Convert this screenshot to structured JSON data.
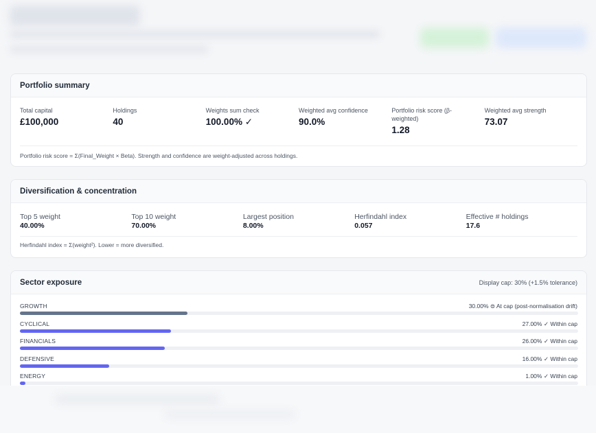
{
  "summary": {
    "title": "Portfolio summary",
    "stats": [
      {
        "label": "Total capital",
        "value": "£100,000"
      },
      {
        "label": "Holdings",
        "value": "40"
      },
      {
        "label": "Weights sum check",
        "value": "100.00% ✓"
      },
      {
        "label": "Weighted avg confidence",
        "value": "90.0%"
      },
      {
        "label": "Portfolio risk score (β-weighted)",
        "value": "1.28"
      },
      {
        "label": "Weighted avg strength",
        "value": "73.07"
      }
    ],
    "footnote": "Portfolio risk score = Σ(Final_Weight × Beta). Strength and confidence are weight-adjusted across holdings."
  },
  "diversification": {
    "title": "Diversification & concentration",
    "stats": [
      {
        "label": "Top 5 weight",
        "value": "40.00%"
      },
      {
        "label": "Top 10 weight",
        "value": "70.00%"
      },
      {
        "label": "Largest position",
        "value": "8.00%"
      },
      {
        "label": "Herfindahl index",
        "value": "0.057"
      },
      {
        "label": "Effective # holdings",
        "value": "17.6"
      }
    ],
    "footnote": "Herfindahl index = Σ(weight²). Lower = more diversified."
  },
  "sector": {
    "title": "Sector exposure",
    "cap_note": "Display cap: 30% (+1.5% tolerance)",
    "rows": [
      {
        "name": "GROWTH",
        "status": "30.00% ⊜ At cap (post-normalisation drift)",
        "weight": 30.0,
        "color": "#64748b"
      },
      {
        "name": "CYCLICAL",
        "status": "27.00% ✓ Within cap",
        "weight": 27.0,
        "color": "#6366f1"
      },
      {
        "name": "FINANCIALS",
        "status": "26.00% ✓ Within cap",
        "weight": 26.0,
        "color": "#6366f1"
      },
      {
        "name": "DEFENSIVE",
        "status": "16.00% ✓ Within cap",
        "weight": 16.0,
        "color": "#6366f1"
      },
      {
        "name": "ENERGY",
        "status": "1.00% ✓ Within cap",
        "weight": 1.0,
        "color": "#6366f1"
      }
    ]
  }
}
